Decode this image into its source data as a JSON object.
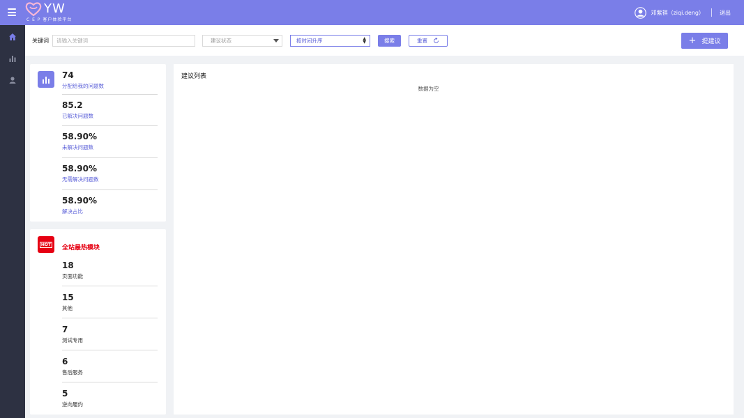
{
  "header": {
    "logo_text": "YW",
    "logo_subtitle": "C E P 客户体验平台",
    "user_name": "邓紫祺（ziqi.deng）",
    "logout_label": "退出",
    "brand_color": "#7a7ee8"
  },
  "sidenav": {
    "items": [
      {
        "icon": "home-icon"
      },
      {
        "icon": "bar-chart-icon"
      },
      {
        "icon": "user-icon"
      }
    ]
  },
  "toolbar": {
    "keyword_label": "关键词",
    "keyword_value": "",
    "keyword_placeholder": "请输入关键词",
    "status_placeholder": "建议状态",
    "sort_value": "按时间升序",
    "search_label": "搜索",
    "reset_label": "重置",
    "suggest_label": "提建议"
  },
  "stats": {
    "icon": "bar-chart-icon",
    "items": [
      {
        "value": "74",
        "label": "分配给我的问题数"
      },
      {
        "value": "85.2",
        "label": "已解决问题数"
      },
      {
        "value": "58.90%",
        "label": "未解决问题数"
      },
      {
        "value": "58.90%",
        "label": "无需解决问题数"
      },
      {
        "value": "58.90%",
        "label": "解决占比"
      }
    ]
  },
  "hot": {
    "icon_text": "HOT",
    "title": "全站最热模块",
    "accent_color": "#e60012",
    "items": [
      {
        "value": "18",
        "label": "页面功能"
      },
      {
        "value": "15",
        "label": "其他"
      },
      {
        "value": "7",
        "label": "测试专用"
      },
      {
        "value": "6",
        "label": "售后服务"
      },
      {
        "value": "5",
        "label": "逆向履约"
      }
    ]
  },
  "list": {
    "title": "建议列表",
    "empty_text": "数据为空"
  }
}
